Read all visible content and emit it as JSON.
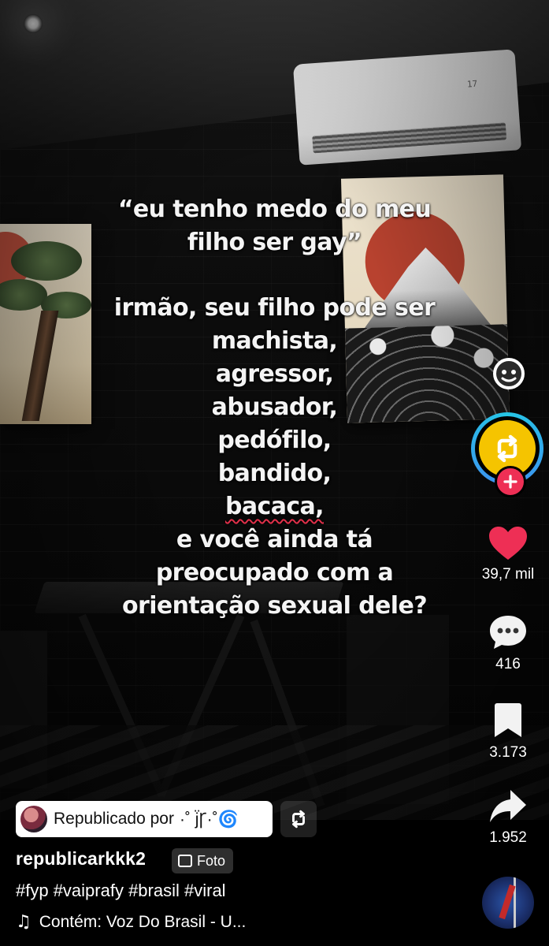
{
  "caption": {
    "quote_lines": [
      "“eu tenho medo do meu",
      "filho ser gay”"
    ],
    "body_lines": [
      "irmão, seu filho pode ser",
      "machista,",
      "agressor,",
      "abusador,",
      "pedófilo,",
      "bandido,",
      "bacaca,",
      "e você ainda tá",
      "preocupado com a",
      "orientação sexual dele?"
    ]
  },
  "ac_display": "17",
  "rail": {
    "likes": "39,7 mil",
    "comments": "416",
    "saves": "3.173",
    "shares": "1.952"
  },
  "colors": {
    "like": "#ee2f55",
    "repost_core": "#f5c400",
    "repost_ring": "#25c6e6",
    "plus_badge": "#ee2f55"
  },
  "icons": [
    "face-icon",
    "repost-icon",
    "plus-icon",
    "heart-icon",
    "comment-icon",
    "bookmark-icon",
    "share-icon",
    "repost-small-icon",
    "photo-icon",
    "music-note-icon"
  ],
  "repost_chip": {
    "label": "Republicado por",
    "name": "·˚ j̈Ꞅ·˚🌀"
  },
  "post": {
    "username": "republicarkkk2",
    "type_tag": "Foto",
    "hashtags": "#fyp #vaiprafy #brasil #viral",
    "music": "Contém: Voz Do Brasil - U..."
  }
}
